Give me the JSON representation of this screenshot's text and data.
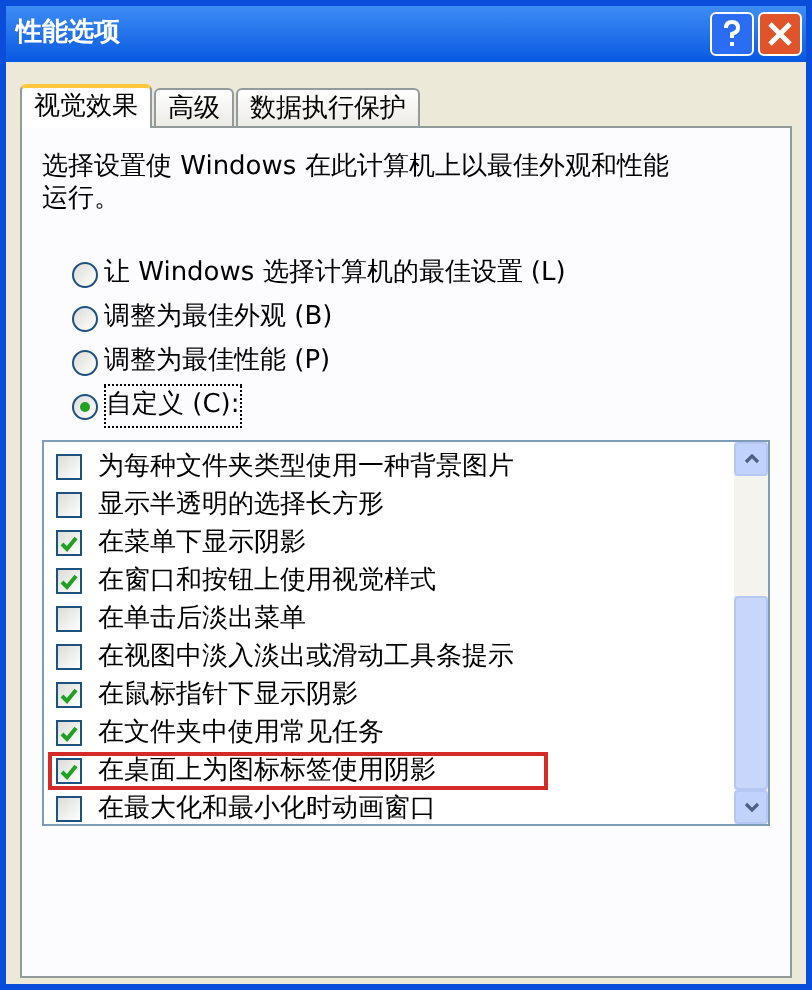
{
  "window": {
    "title": "性能选项"
  },
  "tabs": [
    {
      "label": "视觉效果",
      "selected": true
    },
    {
      "label": "高级",
      "selected": false
    },
    {
      "label": "数据执行保护",
      "selected": false
    }
  ],
  "description": "选择设置使 Windows 在此计算机上以最佳外观和性能运行。",
  "modes": [
    {
      "label": "让 Windows 选择计算机的最佳设置 (L)",
      "selected": false
    },
    {
      "label": "调整为最佳外观 (B)",
      "selected": false
    },
    {
      "label": "调整为最佳性能 (P)",
      "selected": false
    },
    {
      "label": "自定义 (C):",
      "selected": true
    }
  ],
  "options": [
    {
      "label": "为每种文件夹类型使用一种背景图片",
      "checked": false,
      "highlighted": false
    },
    {
      "label": "显示半透明的选择长方形",
      "checked": false,
      "highlighted": false
    },
    {
      "label": "在菜单下显示阴影",
      "checked": true,
      "highlighted": false
    },
    {
      "label": "在窗口和按钮上使用视觉样式",
      "checked": true,
      "highlighted": false
    },
    {
      "label": "在单击后淡出菜单",
      "checked": false,
      "highlighted": false
    },
    {
      "label": "在视图中淡入淡出或滑动工具条提示",
      "checked": false,
      "highlighted": false
    },
    {
      "label": "在鼠标指针下显示阴影",
      "checked": true,
      "highlighted": false
    },
    {
      "label": "在文件夹中使用常见任务",
      "checked": true,
      "highlighted": false
    },
    {
      "label": "在桌面上为图标标签使用阴影",
      "checked": true,
      "highlighted": true
    },
    {
      "label": "在最大化和最小化时动画窗口",
      "checked": false,
      "highlighted": false
    }
  ]
}
